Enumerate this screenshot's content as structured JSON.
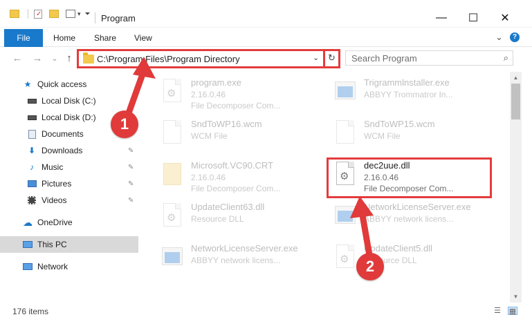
{
  "window": {
    "title": "Program",
    "minimize_glyph": "—",
    "maximize_glyph": "☐",
    "close_glyph": "✕"
  },
  "ribbon": {
    "tabs": [
      "File",
      "Home",
      "Share",
      "View"
    ],
    "expand_glyph": "⌄",
    "help_glyph": "?"
  },
  "nav": {
    "back_glyph": "←",
    "forward_glyph": "→",
    "recent_glyph": "⌄",
    "up_glyph": "↑"
  },
  "address": {
    "path": "C:\\Program Files\\Program Directory",
    "dropdown_glyph": "⌄",
    "refresh_glyph": "↻"
  },
  "search": {
    "placeholder": "Search Program",
    "icon_glyph": "⌕"
  },
  "sidebar": {
    "items": [
      {
        "label": "Quick access",
        "icon": "star-icon"
      },
      {
        "label": "Local Disk (C:)",
        "icon": "drive-icon"
      },
      {
        "label": "Local Disk (D:)",
        "icon": "drive-icon"
      },
      {
        "label": "Documents",
        "icon": "documents-icon"
      },
      {
        "label": "Downloads",
        "icon": "download-icon",
        "pinned": true
      },
      {
        "label": "Music",
        "icon": "music-icon",
        "pinned": true
      },
      {
        "label": "Pictures",
        "icon": "pictures-icon",
        "pinned": true
      },
      {
        "label": "Videos",
        "icon": "videos-icon",
        "pinned": true
      },
      {
        "label": "OneDrive",
        "icon": "cloud-icon"
      },
      {
        "label": "This PC",
        "icon": "pc-icon",
        "selected": true
      },
      {
        "label": "Network",
        "icon": "network-icon"
      }
    ],
    "pin_glyph": "📌"
  },
  "files": [
    {
      "name": "program.exe",
      "line2": "2.16.0.46",
      "line3": "File Decomposer Com...",
      "type": "exe"
    },
    {
      "name": "Trigrammlnstaller.exe",
      "line2": "ABBYY Trommatror In...",
      "line3": "",
      "type": "exe"
    },
    {
      "name": "SndToWP16.wcm",
      "line2": "WCM File",
      "line3": "",
      "type": "doc"
    },
    {
      "name": "SndToWP15.wcm",
      "line2": "WCM File",
      "line3": "",
      "type": "doc"
    },
    {
      "name": "Microsoft.VC90.CRT",
      "line2": "2.16.0.46",
      "line3": "File Decomposer Com...",
      "type": "folder"
    },
    {
      "name": "dec2uue.dll",
      "line2": "2.16.0.46",
      "line3": "File Decomposer Com...",
      "type": "dll",
      "highlighted": true
    },
    {
      "name": "UpdateClient63.dll",
      "line2": "Resource DLL",
      "line3": "",
      "type": "dll"
    },
    {
      "name": "NetworkLicenseServer.exe",
      "line2": "ABBYY network licens...",
      "line3": "",
      "type": "exe"
    },
    {
      "name": "NetworkLicenseServer.exe",
      "line2": "ABBYY network licens...",
      "line3": "",
      "type": "exe"
    },
    {
      "name": "UpdateClient5.dll",
      "line2": "Resource DLL",
      "line3": "",
      "type": "dll"
    }
  ],
  "status": {
    "count": "176 items"
  },
  "callouts": [
    "1",
    "2"
  ],
  "colors": {
    "accent": "#1979ca",
    "annotation_red": "#e03a3a"
  }
}
